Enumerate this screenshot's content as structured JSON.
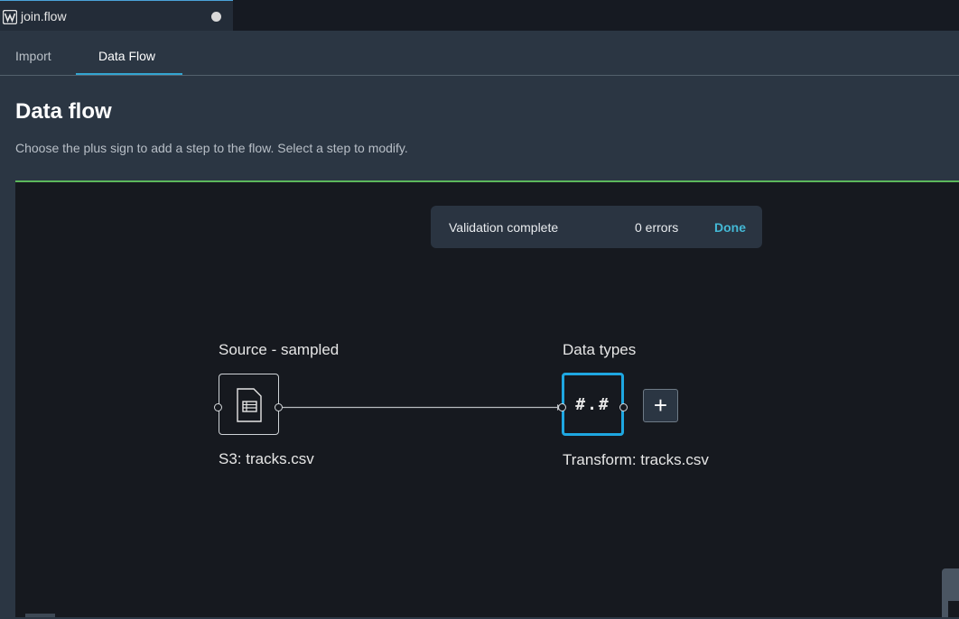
{
  "file_tab": {
    "name": "join.flow",
    "logo_icon": "sagemaker-logo-icon",
    "unsaved_indicator": "dot-icon"
  },
  "tabs": [
    {
      "label": "Import",
      "active": false
    },
    {
      "label": "Data Flow",
      "active": true
    }
  ],
  "header": {
    "title": "Data flow",
    "subtitle": "Choose the plus sign to add a step to the flow. Select a step to modify."
  },
  "toast": {
    "message": "Validation complete",
    "errors": "0 errors",
    "action": "Done"
  },
  "nodes": [
    {
      "title": "Source - sampled",
      "label": "S3: tracks.csv",
      "icon": "document-table-icon"
    },
    {
      "title": "Data types",
      "label": "Transform: tracks.csv",
      "glyph": "#.#"
    }
  ],
  "add_step": {
    "glyph": "+",
    "icon": "plus-icon"
  },
  "colors": {
    "accent": "#1ea7e1",
    "canvas_bg": "#16191f",
    "panel_bg": "#2b3643",
    "status_ok": "#5cb85c",
    "link": "#44b9d6"
  }
}
